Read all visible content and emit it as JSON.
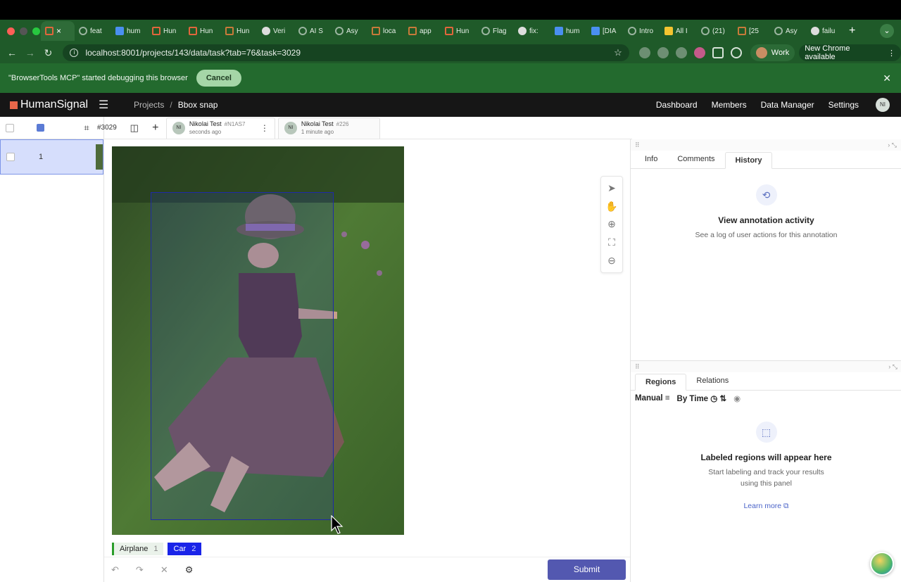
{
  "browser": {
    "active_tab_close": "×",
    "tabs": [
      {
        "label": "feat",
        "fav": "g"
      },
      {
        "label": "hum",
        "fav": "b"
      },
      {
        "label": "Hun",
        "fav": ""
      },
      {
        "label": "Hun",
        "fav": ""
      },
      {
        "label": "Hun",
        "fav": "o"
      },
      {
        "label": "Veri",
        "fav": "w"
      },
      {
        "label": "AI S",
        "fav": "g"
      },
      {
        "label": "Asy",
        "fav": "g"
      },
      {
        "label": "loca",
        "fav": "o"
      },
      {
        "label": "app",
        "fav": "o"
      },
      {
        "label": "Hun",
        "fav": ""
      },
      {
        "label": "Flag",
        "fav": "g"
      },
      {
        "label": "fix:",
        "fav": "w"
      },
      {
        "label": "hum",
        "fav": "b"
      },
      {
        "label": "[DIA",
        "fav": "b"
      },
      {
        "label": "Intro",
        "fav": "g"
      },
      {
        "label": "All I",
        "fav": "y"
      },
      {
        "label": "(21)",
        "fav": "g"
      },
      {
        "label": "[25",
        "fav": "o"
      },
      {
        "label": "Asy",
        "fav": "g"
      },
      {
        "label": "failu",
        "fav": "w"
      }
    ],
    "new_tab": "+",
    "url": "localhost:8001/projects/143/data/task?tab=76&task=3029",
    "profile_label": "Work",
    "update_label": "New Chrome available",
    "debug_message": "\"BrowserTools MCP\" started debugging this browser",
    "debug_cancel": "Cancel"
  },
  "app": {
    "brand": "HumanSignal",
    "breadcrumb_projects": "Projects",
    "breadcrumb_sep": "/",
    "breadcrumb_current": "Bbox snap",
    "nav": [
      "Dashboard",
      "Members",
      "Data Manager",
      "Settings"
    ],
    "user_initials": "NI"
  },
  "task_list": {
    "rows": [
      {
        "id": "1"
      }
    ]
  },
  "task": {
    "id": "#3029",
    "annotations": [
      {
        "initials": "NI",
        "name": "Nikolai Test",
        "aid": "#N1AS7",
        "when": "seconds ago"
      },
      {
        "initials": "NI",
        "name": "Nikolai Test",
        "aid": "#226",
        "when": "1 minute ago"
      }
    ]
  },
  "labels": [
    {
      "name": "Airplane",
      "key": "1",
      "color": "#2b9d2b"
    },
    {
      "name": "Car",
      "key": "2",
      "color": "#1a24e8"
    }
  ],
  "submit_label": "Submit",
  "side_panel": {
    "tabs": [
      "Info",
      "Comments",
      "History"
    ],
    "active_tab": "History",
    "history_title": "View annotation activity",
    "history_sub": "See a log of user actions for this annotation",
    "region_tabs": [
      "Regions",
      "Relations"
    ],
    "region_sort_manual": "Manual",
    "region_sort_time": "By Time",
    "regions_title": "Labeled regions will appear here",
    "regions_sub_1": "Start labeling and track your results",
    "regions_sub_2": "using this panel",
    "learn_more": "Learn more"
  },
  "colors": {
    "brand_accent": "#e8674a",
    "submit": "#5358b0",
    "chrome_green": "#1f5a29"
  }
}
